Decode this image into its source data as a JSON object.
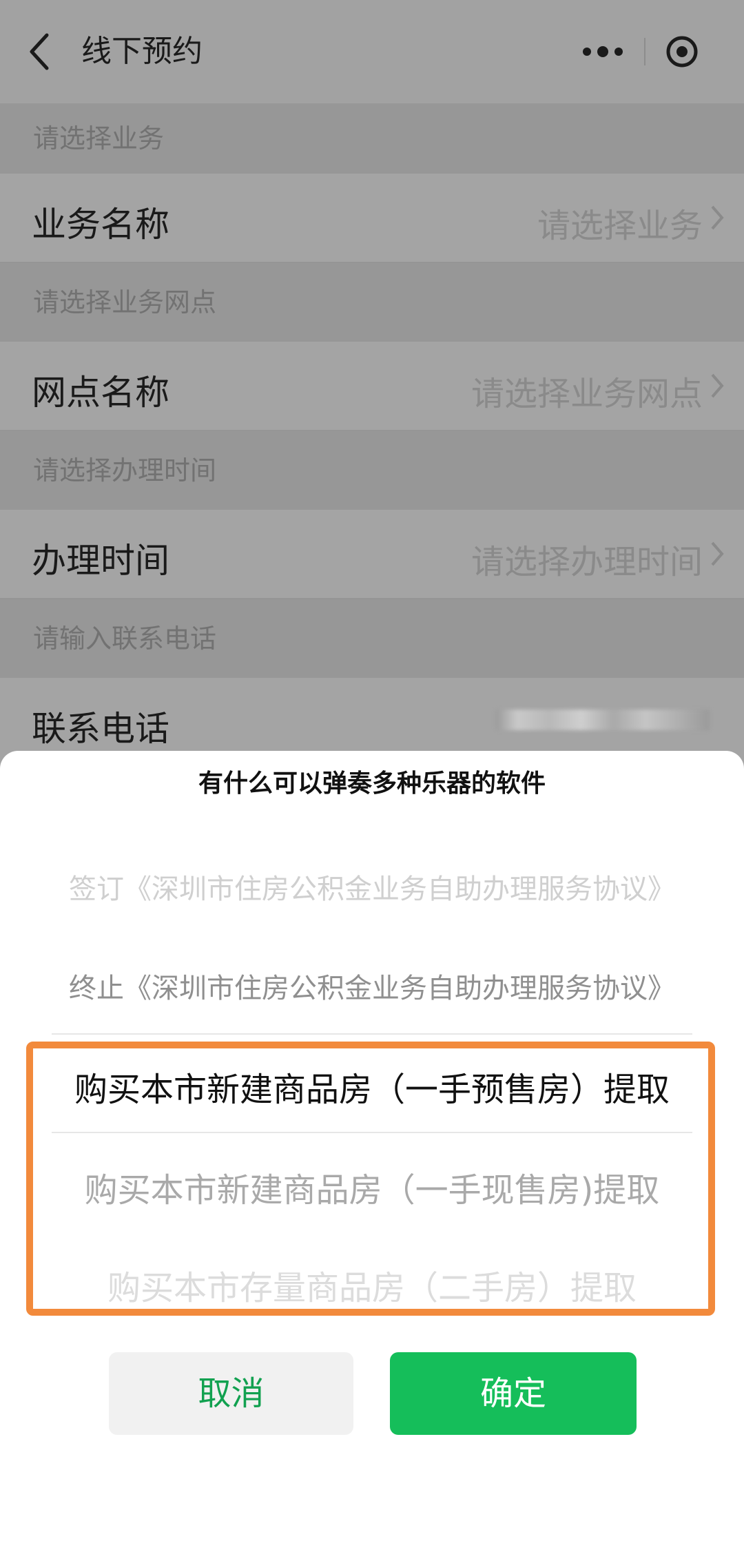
{
  "navbar": {
    "title": "线下预约"
  },
  "form": {
    "sections": [
      {
        "hint": "请选择业务",
        "label": "业务名称",
        "value": "请选择业务"
      },
      {
        "hint": "请选择业务网点",
        "label": "网点名称",
        "value": "请选择业务网点"
      },
      {
        "hint": "请选择办理时间",
        "label": "办理时间",
        "value": "请选择办理时间"
      },
      {
        "hint": "请输入联系电话",
        "label": "联系电话",
        "value": ""
      }
    ]
  },
  "sheet": {
    "title": "有什么可以弹奏多种乐器的软件",
    "options": [
      "签订《深圳市住房公积金业务自助办理服务协议》",
      "终止《深圳市住房公积金业务自助办理服务协议》",
      "购买本市新建商品房（一手预售房）提取",
      "购买本市新建商品房（一手现售房)提取",
      "购买本市存量商品房（二手房）提取"
    ],
    "highlight_color": "#f28a3c",
    "cancel_label": "取消",
    "confirm_label": "确定",
    "confirm_color": "#15be5a"
  }
}
